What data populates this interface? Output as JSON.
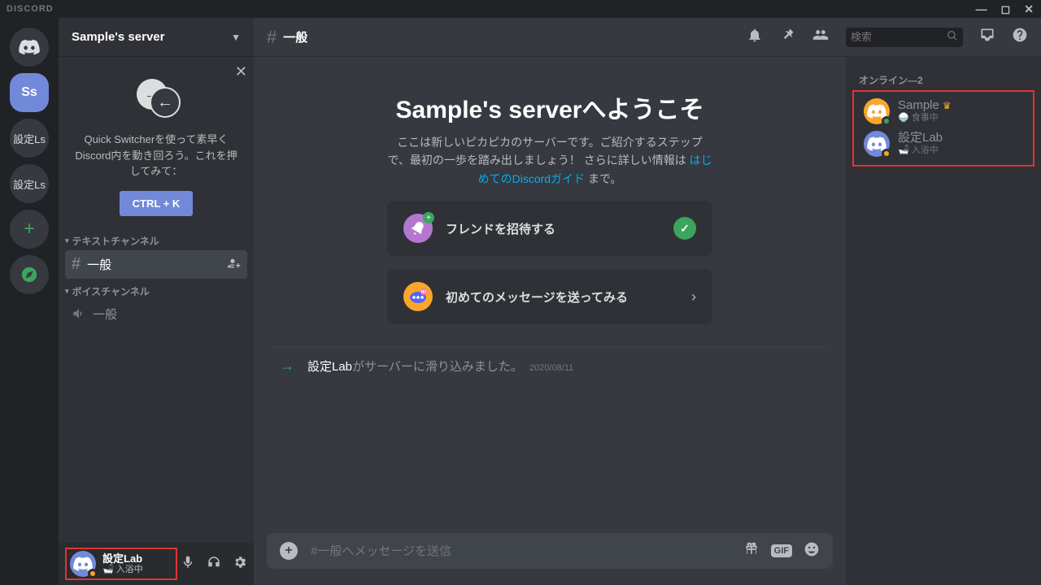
{
  "titlebar": {
    "brand": "DISCORD"
  },
  "servers": {
    "selected_initials": "Ss",
    "folder1": "設定Ls",
    "folder2": "設定Ls"
  },
  "sidebar": {
    "server_name": "Sample's server",
    "quickswitcher_text": "Quick Switcherを使って素早くDiscord内を動き回ろう。これを押してみて：",
    "quickswitcher_btn": "CTRL + K",
    "cat_text": "テキストチャンネル",
    "ch_text_general": "一般",
    "cat_voice": "ボイスチャンネル",
    "ch_voice_general": "一般"
  },
  "user_panel": {
    "name": "設定Lab",
    "status_emoji": "🛁",
    "status_text": "入浴中"
  },
  "header": {
    "channel": "一般",
    "search_placeholder": "検索"
  },
  "welcome": {
    "title": "Sample's serverへようこそ",
    "desc_1": "ここは新しいピカピカのサーバーです。ご紹介するステップで、最初の一歩を踏み出しましょう！ さらに詳しい情報は ",
    "desc_link": "はじめてのDiscordガイド",
    "desc_2": " まで。",
    "step1": "フレンドを招待する",
    "step2": "初めてのメッセージを送ってみる",
    "sysmsg_user": "設定Lab",
    "sysmsg_rest": "がサーバーに滑り込みました。",
    "sysmsg_date": "2020/08/11"
  },
  "composer": {
    "placeholder": "#一般へメッセージを送信"
  },
  "members": {
    "header": "オンライン—2",
    "m1_name": "Sample",
    "m1_sub_emoji": "🍚",
    "m1_sub": "食事中",
    "m2_name": "設定Lab",
    "m2_sub_emoji": "🛁",
    "m2_sub": "入浴中"
  }
}
